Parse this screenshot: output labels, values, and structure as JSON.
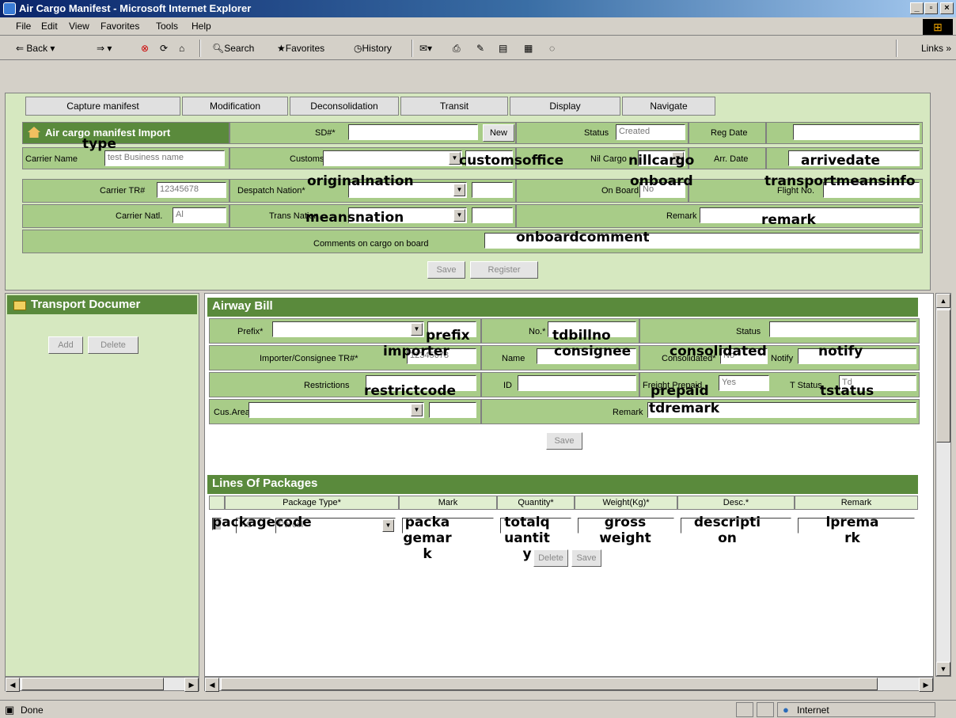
{
  "window": {
    "title": "Air Cargo Manifest - Microsoft Internet Explorer"
  },
  "menu": [
    "File",
    "Edit",
    "View",
    "Favorites",
    "Tools",
    "Help"
  ],
  "toolbar": {
    "back": "Back",
    "search": "Search",
    "favorites": "Favorites",
    "history": "History",
    "links": "Links"
  },
  "tabs": [
    "Capture manifest",
    "Modification",
    "Deconsolidation",
    "Transit",
    "Display",
    "Navigate"
  ],
  "manifest": {
    "header": "Air cargo manifest Import",
    "sd_label": "SD#*",
    "new_label": "New",
    "status_label": "Status",
    "status_value": "Created",
    "reg_date_label": "Reg Date",
    "carrier_name_label": "Carrier Name",
    "carrier_name_value": "test Business name",
    "customs_label": "Customs*",
    "nill_cargo_label": "Nil Cargo",
    "arr_date_label": "Arr. Date",
    "carrier_tr_label": "Carrier TR#",
    "carrier_tr_value": "12345678",
    "despatch_label": "Despatch Nation*",
    "on_board_label": "On Board",
    "on_board_value": "No",
    "flight_label": "Flight No.",
    "carrier_natl_label": "Carrier Natl.",
    "carrier_natl_value": "Al",
    "trans_label": "Trans Nation",
    "remark_label": "Remark",
    "comments_label": "Comments on cargo on board",
    "save_label": "Save",
    "register_label": "Register"
  },
  "left": {
    "title": "Transport Documer",
    "add": "Add",
    "delete": "Delete"
  },
  "airway": {
    "title": "Airway Bill",
    "prefix_label": "Prefix*",
    "no_label": "No.*",
    "status_label": "Status",
    "importer_label": "Importer/Consignee TR#*",
    "importer_value": "12345678",
    "name_label": "Name",
    "consolidated_label": "Consolidated*",
    "consolidated_value": "No",
    "notify_label": "Notify",
    "restrictions_label": "Restrictions",
    "id_label": "ID",
    "freight_label": "Freight Prepaid",
    "freight_value": "Yes",
    "tstatus_label": "T Status",
    "tstatus_value": "Td",
    "cusarea_label": "Cus.Area",
    "remark_label": "Remark",
    "save_label": "Save"
  },
  "packages": {
    "title": "Lines Of Packages",
    "columns": [
      "Package Type*",
      "Mark",
      "Quantity*",
      "Weight(Kg)*",
      "Desc.*",
      "Remark"
    ],
    "row": {
      "code": "P.C",
      "type": "Parcel"
    },
    "delete_label": "Delete",
    "save_label": "Save"
  },
  "overlays": {
    "type": "type",
    "customsoffice": "customsoffice",
    "nillcargo": "nillcargo",
    "arrivedate": "arrivedate",
    "originalnation": "originalnation",
    "onboard": "onboard",
    "transportmeansinfo": "transportmeansinfo",
    "meansnation": "meansnation",
    "remark": "remark",
    "onboardcomment": "onboardcomment",
    "prefix": "prefix",
    "tdbillno": "tdbillno",
    "importer": "importer",
    "consignee": "consignee",
    "consolidated": "consolidated",
    "notify": "notify",
    "restrictcode": "restrictcode",
    "prepaid": "prepaid",
    "tstatus": "tstatus",
    "tdremark": "tdremark",
    "packagecode": "packagecode",
    "packagemark": "packa gemar k",
    "totalquantity": "totalq uantit y",
    "grossweight": "gross weight",
    "description": "descripti on",
    "lpremark": "lprema rk"
  },
  "status": {
    "left": "Done",
    "zone": "Internet"
  }
}
